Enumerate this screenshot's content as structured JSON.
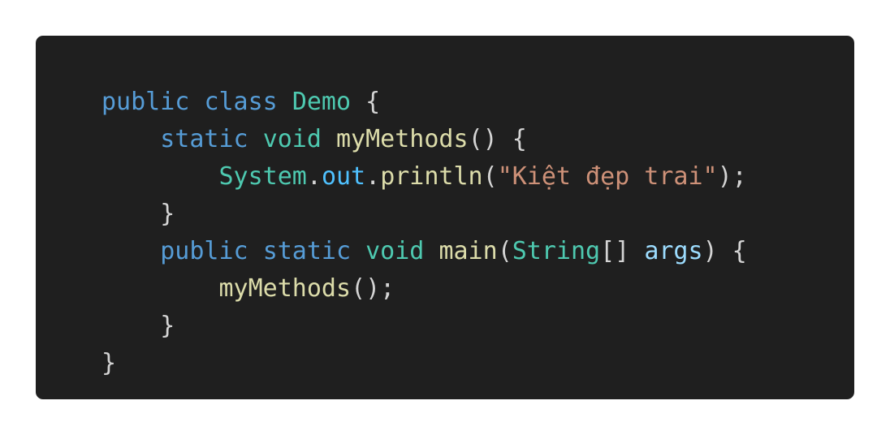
{
  "lines": [
    {
      "tokens": [
        {
          "t": "public",
          "k": "kw"
        },
        {
          "t": " ",
          "k": "pun"
        },
        {
          "t": "class",
          "k": "kw"
        },
        {
          "t": " ",
          "k": "pun"
        },
        {
          "t": "Demo",
          "k": "type"
        },
        {
          "t": " {",
          "k": "pun"
        }
      ]
    },
    {
      "tokens": [
        {
          "t": "    ",
          "k": "pun"
        },
        {
          "t": "static",
          "k": "kw"
        },
        {
          "t": " ",
          "k": "pun"
        },
        {
          "t": "void",
          "k": "type"
        },
        {
          "t": " ",
          "k": "pun"
        },
        {
          "t": "myMethods",
          "k": "fn"
        },
        {
          "t": "() {",
          "k": "pun"
        }
      ]
    },
    {
      "tokens": [
        {
          "t": "        ",
          "k": "pun"
        },
        {
          "t": "System",
          "k": "type"
        },
        {
          "t": ".",
          "k": "pun"
        },
        {
          "t": "out",
          "k": "fld"
        },
        {
          "t": ".",
          "k": "pun"
        },
        {
          "t": "println",
          "k": "fn"
        },
        {
          "t": "(",
          "k": "pun"
        },
        {
          "t": "\"Kiệt đẹp trai\"",
          "k": "str"
        },
        {
          "t": ");",
          "k": "pun"
        }
      ]
    },
    {
      "tokens": [
        {
          "t": "    }",
          "k": "pun"
        }
      ]
    },
    {
      "tokens": [
        {
          "t": "    ",
          "k": "pun"
        },
        {
          "t": "public",
          "k": "kw"
        },
        {
          "t": " ",
          "k": "pun"
        },
        {
          "t": "static",
          "k": "kw"
        },
        {
          "t": " ",
          "k": "pun"
        },
        {
          "t": "void",
          "k": "type"
        },
        {
          "t": " ",
          "k": "pun"
        },
        {
          "t": "main",
          "k": "fn"
        },
        {
          "t": "(",
          "k": "pun"
        },
        {
          "t": "String",
          "k": "type"
        },
        {
          "t": "[] ",
          "k": "pun"
        },
        {
          "t": "args",
          "k": "var"
        },
        {
          "t": ") {",
          "k": "pun"
        }
      ]
    },
    {
      "tokens": [
        {
          "t": "        ",
          "k": "pun"
        },
        {
          "t": "myMethods",
          "k": "fn"
        },
        {
          "t": "();",
          "k": "pun"
        }
      ]
    },
    {
      "tokens": [
        {
          "t": "    }",
          "k": "pun"
        }
      ]
    },
    {
      "tokens": [
        {
          "t": "}",
          "k": "pun"
        }
      ]
    }
  ]
}
